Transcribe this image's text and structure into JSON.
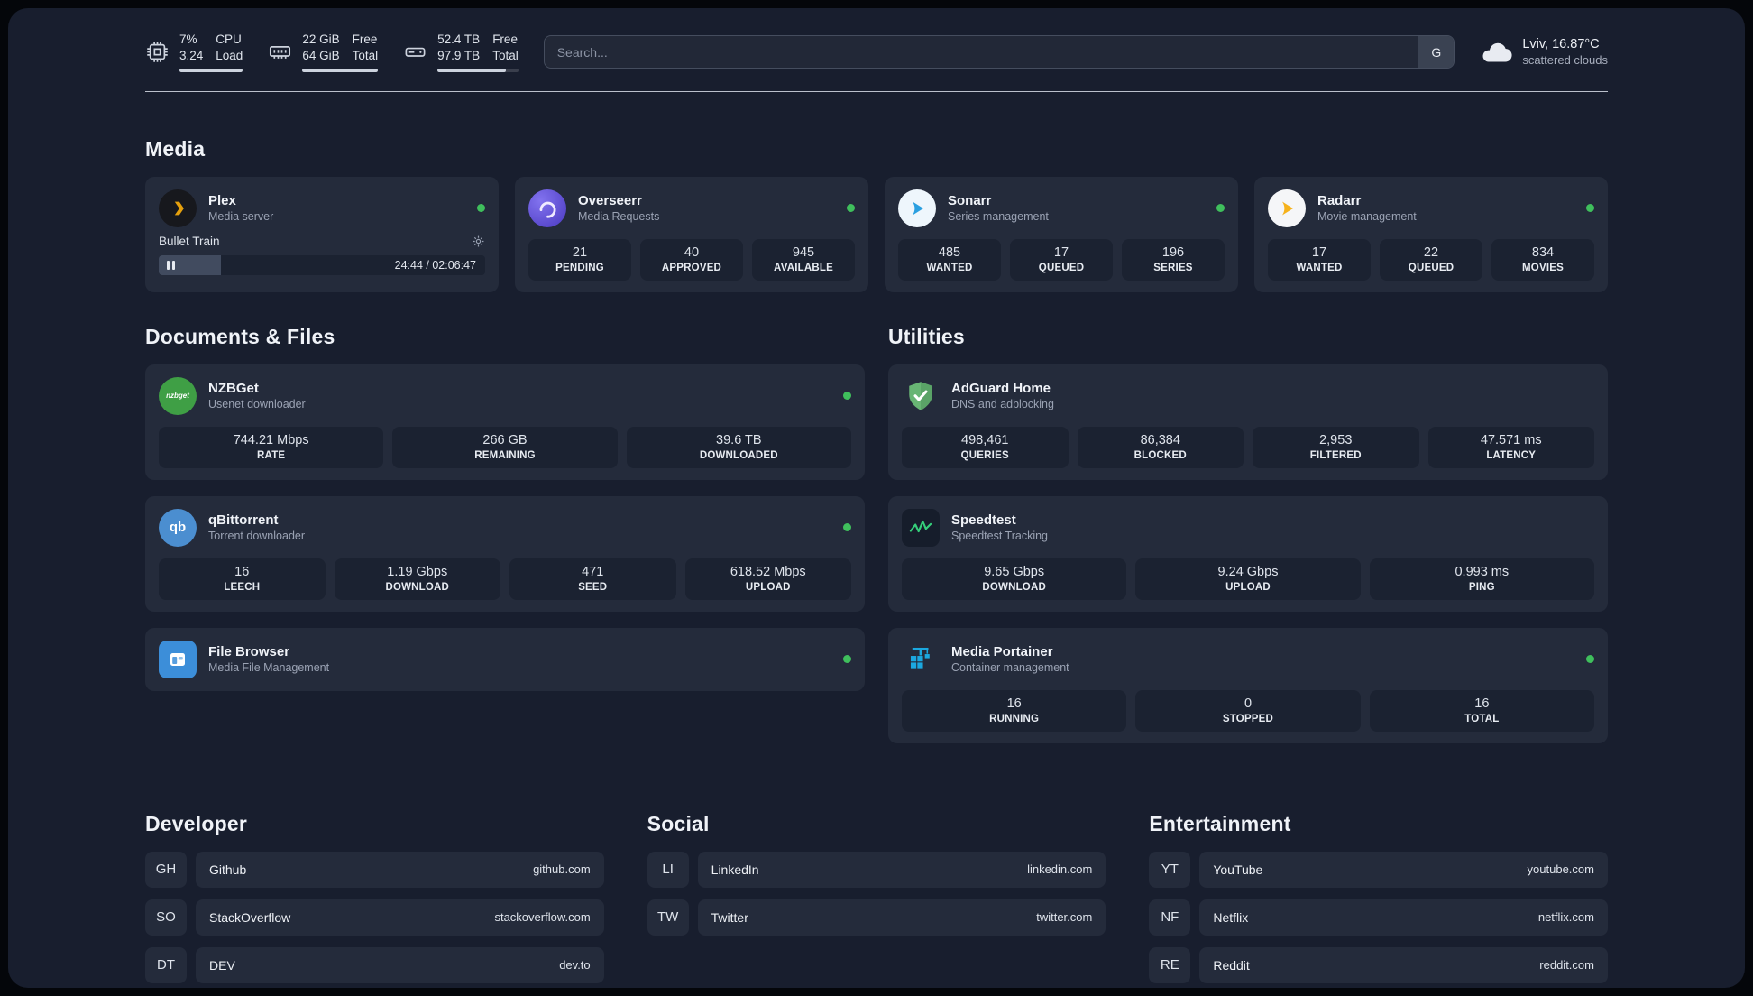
{
  "colors": {
    "background": "#181e2e",
    "card": "#242b3b",
    "stat_tile": "#1b2231",
    "status_online": "#3fbf5c",
    "plex_amber": "#e5a00d",
    "overseerr_purple": "#5a48d4",
    "sonarr_blue": "#2a9fe0",
    "radarr_amber": "#f6b21b",
    "nzbget_green": "#3f9f45",
    "qbittorrent_blue": "#4b8ed0",
    "adguard_green": "#68b574",
    "speedtest_green": "#35cf7a",
    "portainer_blue": "#1ba8e0"
  },
  "topbar": {
    "cpu": {
      "icon": "cpu-chip-icon",
      "value_top": "7%",
      "value_bottom": "3.24",
      "label_top": "CPU",
      "label_bottom": "Load"
    },
    "memory": {
      "icon": "ram-icon",
      "value_top": "22 GiB",
      "value_bottom": "64 GiB",
      "label_top": "Free",
      "label_bottom": "Total"
    },
    "disk": {
      "icon": "hard-drive-icon",
      "value_top": "52.4 TB",
      "value_bottom": "97.9 TB",
      "label_top": "Free",
      "label_bottom": "Total"
    },
    "search": {
      "placeholder": "Search...",
      "engine_button": "G"
    },
    "weather": {
      "icon": "cloud-icon",
      "location": "Lviv, 16.87°C",
      "condition": "scattered clouds"
    }
  },
  "sections": {
    "media": {
      "title": "Media",
      "plex": {
        "title": "Plex",
        "subtitle": "Media server",
        "status": "online",
        "now_playing": "Bullet Train",
        "time": "24:44 / 02:06:47",
        "progress_percent": 19
      },
      "overseerr": {
        "title": "Overseerr",
        "subtitle": "Media Requests",
        "status": "online",
        "stats": [
          {
            "value": "21",
            "label": "PENDING"
          },
          {
            "value": "40",
            "label": "APPROVED"
          },
          {
            "value": "945",
            "label": "AVAILABLE"
          }
        ]
      },
      "sonarr": {
        "title": "Sonarr",
        "subtitle": "Series management",
        "status": "online",
        "stats": [
          {
            "value": "485",
            "label": "WANTED"
          },
          {
            "value": "17",
            "label": "QUEUED"
          },
          {
            "value": "196",
            "label": "SERIES"
          }
        ]
      },
      "radarr": {
        "title": "Radarr",
        "subtitle": "Movie management",
        "status": "online",
        "stats": [
          {
            "value": "17",
            "label": "WANTED"
          },
          {
            "value": "22",
            "label": "QUEUED"
          },
          {
            "value": "834",
            "label": "MOVIES"
          }
        ]
      }
    },
    "documents": {
      "title": "Documents & Files",
      "nzbget": {
        "title": "NZBGet",
        "subtitle": "Usenet downloader",
        "status": "online",
        "logo_text": "nzbget",
        "stats": [
          {
            "value": "744.21 Mbps",
            "label": "RATE"
          },
          {
            "value": "266 GB",
            "label": "REMAINING"
          },
          {
            "value": "39.6 TB",
            "label": "DOWNLOADED"
          }
        ]
      },
      "qbittorrent": {
        "title": "qBittorrent",
        "subtitle": "Torrent downloader",
        "status": "online",
        "logo_text": "qb",
        "stats": [
          {
            "value": "16",
            "label": "LEECH"
          },
          {
            "value": "1.19 Gbps",
            "label": "DOWNLOAD"
          },
          {
            "value": "471",
            "label": "SEED"
          },
          {
            "value": "618.52 Mbps",
            "label": "UPLOAD"
          }
        ]
      },
      "filebrowser": {
        "title": "File Browser",
        "subtitle": "Media File Management",
        "status": "online"
      }
    },
    "utilities": {
      "title": "Utilities",
      "adguard": {
        "title": "AdGuard Home",
        "subtitle": "DNS and adblocking",
        "stats": [
          {
            "value": "498,461",
            "label": "QUERIES"
          },
          {
            "value": "86,384",
            "label": "BLOCKED"
          },
          {
            "value": "2,953",
            "label": "FILTERED"
          },
          {
            "value": "47.571 ms",
            "label": "LATENCY"
          }
        ]
      },
      "speedtest": {
        "title": "Speedtest",
        "subtitle": "Speedtest Tracking",
        "stats": [
          {
            "value": "9.65 Gbps",
            "label": "DOWNLOAD"
          },
          {
            "value": "9.24 Gbps",
            "label": "UPLOAD"
          },
          {
            "value": "0.993 ms",
            "label": "PING"
          }
        ]
      },
      "portainer": {
        "title": "Media Portainer",
        "subtitle": "Container management",
        "status": "online",
        "stats": [
          {
            "value": "16",
            "label": "RUNNING"
          },
          {
            "value": "0",
            "label": "STOPPED"
          },
          {
            "value": "16",
            "label": "TOTAL"
          }
        ]
      }
    }
  },
  "bookmarks": {
    "developer": {
      "title": "Developer",
      "items": [
        {
          "abbr": "GH",
          "name": "Github",
          "url": "github.com"
        },
        {
          "abbr": "SO",
          "name": "StackOverflow",
          "url": "stackoverflow.com"
        },
        {
          "abbr": "DT",
          "name": "DEV",
          "url": "dev.to"
        }
      ]
    },
    "social": {
      "title": "Social",
      "items": [
        {
          "abbr": "LI",
          "name": "LinkedIn",
          "url": "linkedin.com"
        },
        {
          "abbr": "TW",
          "name": "Twitter",
          "url": "twitter.com"
        }
      ]
    },
    "entertainment": {
      "title": "Entertainment",
      "items": [
        {
          "abbr": "YT",
          "name": "YouTube",
          "url": "youtube.com"
        },
        {
          "abbr": "NF",
          "name": "Netflix",
          "url": "netflix.com"
        },
        {
          "abbr": "RE",
          "name": "Reddit",
          "url": "reddit.com"
        }
      ]
    }
  }
}
